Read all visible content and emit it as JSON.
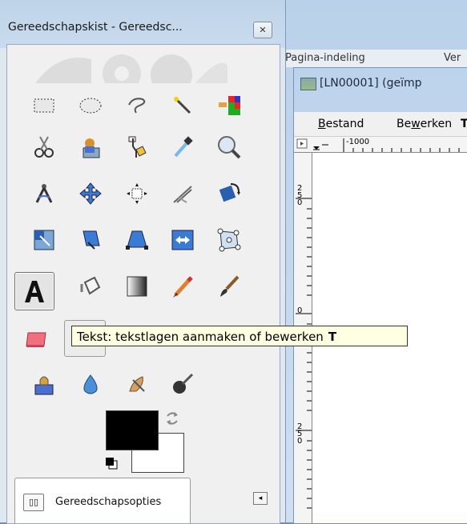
{
  "toolbox": {
    "title": "Gereedschapskist - Gereedsc...",
    "close_glyph": "✕",
    "tools": [
      {
        "name": "rect-select-icon"
      },
      {
        "name": "ellipse-select-icon"
      },
      {
        "name": "free-select-icon"
      },
      {
        "name": "fuzzy-select-icon"
      },
      {
        "name": "select-by-color-icon"
      },
      {
        "name": "scissors-select-icon"
      },
      {
        "name": "foreground-select-icon"
      },
      {
        "name": "paths-icon"
      },
      {
        "name": "color-picker-icon"
      },
      {
        "name": "zoom-icon"
      },
      {
        "name": "measure-icon"
      },
      {
        "name": "move-icon"
      },
      {
        "name": "align-icon"
      },
      {
        "name": "crop-icon"
      },
      {
        "name": "rotate-icon"
      },
      {
        "name": "scale-icon"
      },
      {
        "name": "shear-icon"
      },
      {
        "name": "perspective-icon"
      },
      {
        "name": "flip-icon"
      },
      {
        "name": "cage-transform-icon"
      },
      {
        "name": "text-tool-icon"
      },
      {
        "name": "bucket-fill-icon"
      },
      {
        "name": "blend-icon"
      },
      {
        "name": "pencil-icon"
      },
      {
        "name": "paintbrush-icon"
      },
      {
        "name": "eraser-icon"
      },
      {
        "name": "airbrush-icon"
      },
      {
        "name": "clone-icon"
      },
      {
        "name": "blur-icon"
      },
      {
        "name": "smudge-icon"
      },
      {
        "name": "dodge-burn-icon"
      }
    ],
    "tooltip": {
      "text": "Tekst: tekstlagen aanmaken of bewerken",
      "shortcut": "T"
    },
    "colors": {
      "foreground": "#000000",
      "background": "#ffffff"
    },
    "options_tab": {
      "label": "Gereedschapsopties",
      "icon_glyph": "▯▯"
    },
    "tab_menu_glyph": "◂"
  },
  "background_window": {
    "menu_items": [
      "Pagina-indeling",
      "Ver"
    ]
  },
  "image_window": {
    "title": "[LN00001] (geïmp",
    "menu": {
      "bestand": "Bestand",
      "bewerken": "Bewerken",
      "bewerken_underline": "w",
      "tail": "T"
    },
    "ruler_top_label": "-1000",
    "ruler_left_labels": [
      "250",
      "0",
      "250"
    ]
  }
}
